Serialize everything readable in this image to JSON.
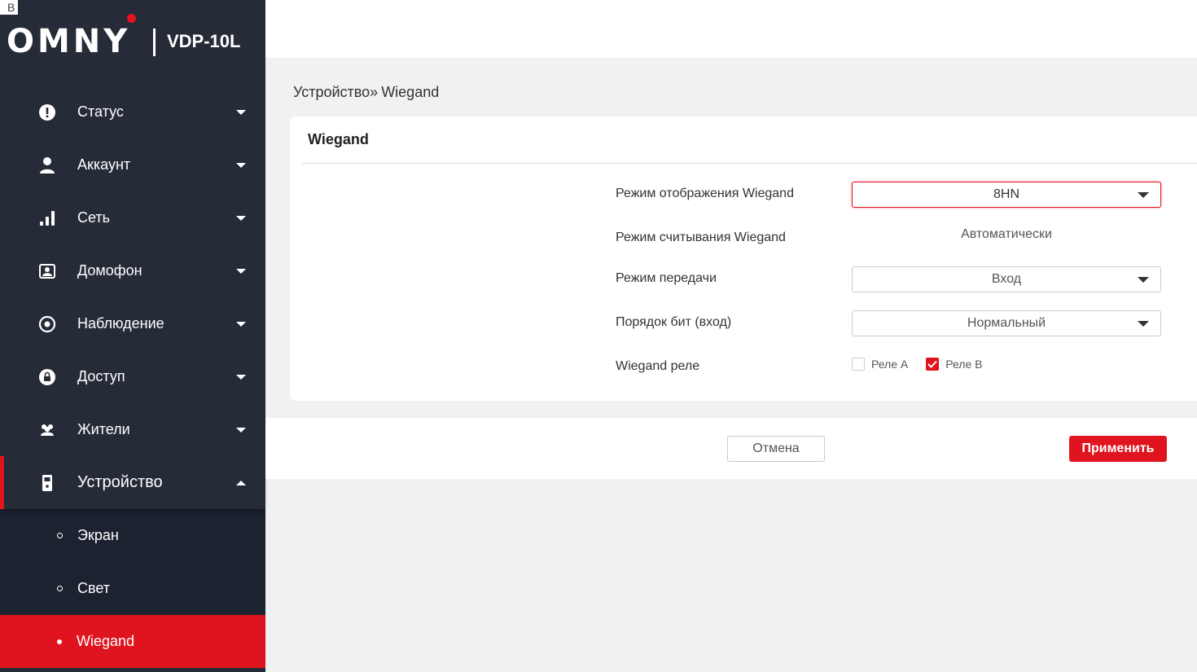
{
  "browser_mark": "B",
  "brand": {
    "logo": "OMNY",
    "model": "VDP-10L",
    "accent": "#e0141e"
  },
  "sidebar": {
    "items": [
      {
        "label": "Статус",
        "icon": "alert-circle-icon"
      },
      {
        "label": "Аккаунт",
        "icon": "user-icon"
      },
      {
        "label": "Сеть",
        "icon": "signal-bars-icon"
      },
      {
        "label": "Домофон",
        "icon": "intercom-icon"
      },
      {
        "label": "Наблюдение",
        "icon": "eye-icon"
      },
      {
        "label": "Доступ",
        "icon": "lock-icon"
      },
      {
        "label": "Жители",
        "icon": "residents-icon"
      },
      {
        "label": "Устройство",
        "icon": "device-icon",
        "expanded": true
      }
    ],
    "subitems": [
      {
        "label": "Экран"
      },
      {
        "label": "Свет"
      },
      {
        "label": "Wiegand",
        "selected": true
      }
    ]
  },
  "breadcrumb": {
    "parent": "Устройство",
    "separator": "»",
    "current": "Wiegand"
  },
  "card": {
    "title": "Wiegand",
    "display_mode": {
      "label": "Режим отображения Wiegand",
      "value": "8HN"
    },
    "read_mode": {
      "label": "Режим считывания Wiegand",
      "value": "Автоматически"
    },
    "transfer_mode": {
      "label": "Режим передачи",
      "value": "Вход"
    },
    "bit_order": {
      "label": "Порядок бит (вход)",
      "value": "Нормальный"
    },
    "relay": {
      "label": "Wiegand реле",
      "relay_a": {
        "label": "Реле А",
        "checked": false
      },
      "relay_b": {
        "label": "Реле В",
        "checked": true
      }
    }
  },
  "footer": {
    "cancel": "Отмена",
    "apply": "Применить"
  }
}
